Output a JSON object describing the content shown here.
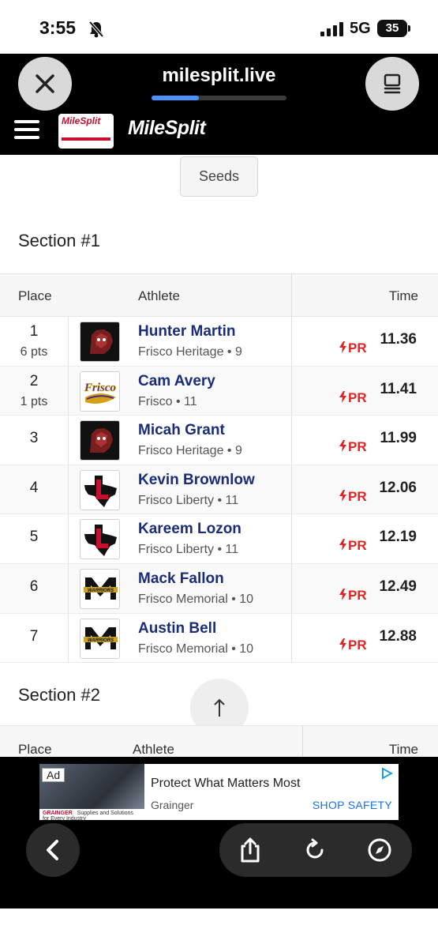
{
  "status_bar": {
    "time": "3:55",
    "network": "5G",
    "battery": "35"
  },
  "browser": {
    "url": "milesplit.live",
    "load_progress": 0.35
  },
  "site": {
    "brand": "MileSplit",
    "logo_small_text": "MileSplit"
  },
  "seeds_button": "Seeds",
  "sections": [
    {
      "title": "Section #1",
      "headers": {
        "place": "Place",
        "athlete": "Athlete",
        "time": "Time"
      },
      "rows": [
        {
          "place": "1",
          "pts": "6 pts",
          "name": "Hunter Martin",
          "meta": "Frisco Heritage • 9",
          "pr": "PR",
          "time": "11.36",
          "logo": "heritage"
        },
        {
          "place": "2",
          "pts": "1 pts",
          "name": "Cam Avery",
          "meta": "Frisco • 11",
          "pr": "PR",
          "time": "11.41",
          "logo": "frisco"
        },
        {
          "place": "3",
          "pts": "",
          "name": "Micah Grant",
          "meta": "Frisco Heritage • 9",
          "pr": "PR",
          "time": "11.99",
          "logo": "heritage"
        },
        {
          "place": "4",
          "pts": "",
          "name": "Kevin Brownlow",
          "meta": "Frisco Liberty • 11",
          "pr": "PR",
          "time": "12.06",
          "logo": "liberty"
        },
        {
          "place": "5",
          "pts": "",
          "name": "Kareem Lozon",
          "meta": "Frisco Liberty • 11",
          "pr": "PR",
          "time": "12.19",
          "logo": "liberty"
        },
        {
          "place": "6",
          "pts": "",
          "name": "Mack Fallon",
          "meta": "Frisco Memorial • 10",
          "pr": "PR",
          "time": "12.49",
          "logo": "memorial"
        },
        {
          "place": "7",
          "pts": "",
          "name": "Austin Bell",
          "meta": "Frisco Memorial • 10",
          "pr": "PR",
          "time": "12.88",
          "logo": "memorial"
        }
      ]
    },
    {
      "title": "Section #2",
      "headers": {
        "place": "Place",
        "athlete": "Athlete",
        "time": "Time"
      }
    }
  ],
  "ad": {
    "tag": "Ad",
    "headline": "Protect What Matters Most",
    "advertiser": "Grainger",
    "cta": "SHOP SAFETY",
    "image_brand": "GRAINGER",
    "image_tagline": "Supplies and Solutions for Every Industry"
  },
  "colors": {
    "accent_link": "#1b2d7a",
    "pr_red": "#e02424",
    "progress_blue": "#4a90ff"
  },
  "icons": [
    "bell-slash-icon",
    "signal-icon",
    "close-icon",
    "reader-icon",
    "hamburger-icon",
    "arrow-up-icon",
    "chevron-left-icon",
    "share-icon",
    "reload-icon",
    "compass-icon",
    "ad-choices-icon",
    "lightning-icon"
  ]
}
